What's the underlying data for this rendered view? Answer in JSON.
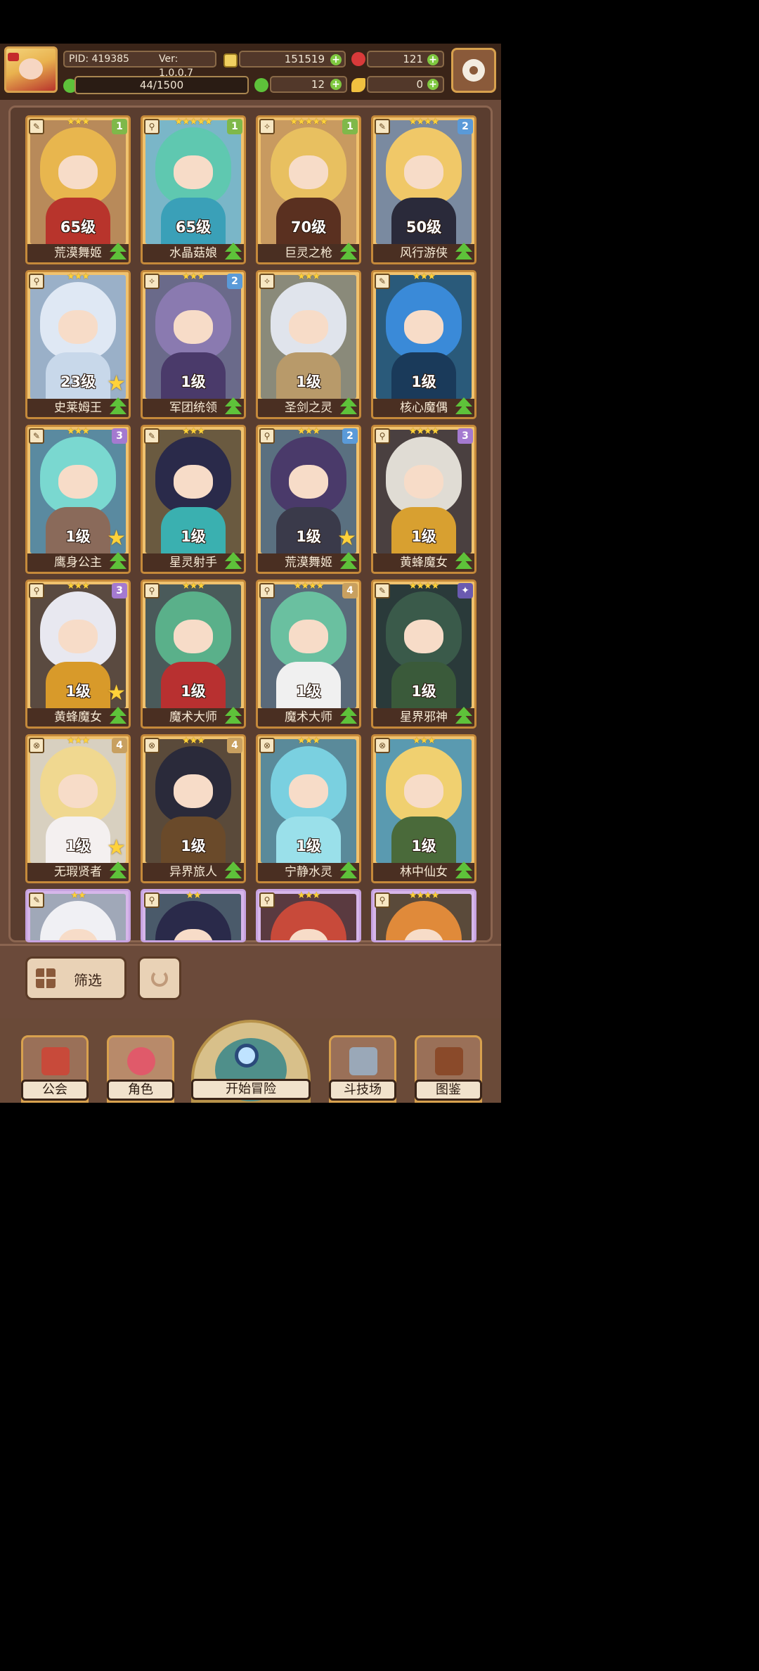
{
  "header": {
    "pid": "PID: 419385",
    "version": "Ver: 1.0.0.7",
    "gold": "151519",
    "gems": "121",
    "stamina": "44/1500",
    "clover": "12",
    "key": "0"
  },
  "cards": [
    {
      "stars": "★★★",
      "level": "65级",
      "name": "荒漠舞姬",
      "rank": "1",
      "rank_color": "#7fb84a",
      "hair": "#e8b64e",
      "bg": "#b88a5a",
      "outfit": "#b8342c",
      "fav": false,
      "type": "✎"
    },
    {
      "stars": "★★★★★",
      "level": "65级",
      "name": "水晶菇娘",
      "rank": "1",
      "rank_color": "#7fb84a",
      "hair": "#5fc8b0",
      "bg": "#7ab6c8",
      "outfit": "#3aa0b8",
      "fav": false,
      "type": "⚲"
    },
    {
      "stars": "★★★★★",
      "level": "70级",
      "name": "巨灵之枪",
      "rank": "1",
      "rank_color": "#7fb84a",
      "hair": "#e8c060",
      "bg": "#c89a60",
      "outfit": "#5a3020",
      "fav": false,
      "type": "✧"
    },
    {
      "stars": "★★★★",
      "level": "50级",
      "name": "风行游侠",
      "rank": "2",
      "rank_color": "#5a9ad8",
      "hair": "#f0c868",
      "bg": "#7a8aa0",
      "outfit": "#2a2a3a",
      "fav": false,
      "type": "✎"
    },
    {
      "stars": "★★★",
      "level": "23级",
      "name": "史莱姆王",
      "rank": "",
      "rank_color": "",
      "hair": "#dfe8f4",
      "bg": "#9ab0c8",
      "outfit": "#c8d8ea",
      "fav": true,
      "type": "⚲"
    },
    {
      "stars": "★★★",
      "level": "1级",
      "name": "军团统领",
      "rank": "2",
      "rank_color": "#5a9ad8",
      "hair": "#8a7ab0",
      "bg": "#6a6a8a",
      "outfit": "#4a3a6a",
      "fav": false,
      "type": "✧"
    },
    {
      "stars": "★★★",
      "level": "1级",
      "name": "圣剑之灵",
      "rank": "",
      "rank_color": "",
      "hair": "#e0e4ec",
      "bg": "#8a8a7a",
      "outfit": "#b89a6a",
      "fav": false,
      "type": "✧"
    },
    {
      "stars": "★★★",
      "level": "1级",
      "name": "核心魔偶",
      "rank": "",
      "rank_color": "",
      "hair": "#3a8ad8",
      "bg": "#2a5a7a",
      "outfit": "#1a3a5a",
      "fav": false,
      "type": "✎"
    },
    {
      "stars": "★★★",
      "level": "1级",
      "name": "鹰身公主",
      "rank": "3",
      "rank_color": "#a47ad0",
      "hair": "#7ad8d0",
      "bg": "#5a8aa0",
      "outfit": "#8a6a5a",
      "fav": true,
      "type": "✎"
    },
    {
      "stars": "★★★",
      "level": "1级",
      "name": "星灵射手",
      "rank": "",
      "rank_color": "",
      "hair": "#2a2a4a",
      "bg": "#6a5a40",
      "outfit": "#3ab0b0",
      "fav": false,
      "type": "✎"
    },
    {
      "stars": "★★★",
      "level": "1级",
      "name": "荒漠舞姬",
      "rank": "2",
      "rank_color": "#5a9ad8",
      "hair": "#4a3a6a",
      "bg": "#5a7080",
      "outfit": "#3a3a4a",
      "fav": true,
      "type": "⚲"
    },
    {
      "stars": "★★★★",
      "level": "1级",
      "name": "黄蜂魔女",
      "rank": "3",
      "rank_color": "#a47ad0",
      "hair": "#e0dcd4",
      "bg": "#4a4040",
      "outfit": "#d8a030",
      "fav": false,
      "type": "⚲"
    },
    {
      "stars": "★★★",
      "level": "1级",
      "name": "黄蜂魔女",
      "rank": "3",
      "rank_color": "#a47ad0",
      "hair": "#e8e8f0",
      "bg": "#5a4a40",
      "outfit": "#d89a2a",
      "fav": true,
      "type": "⚲"
    },
    {
      "stars": "★★★",
      "level": "1级",
      "name": "魔术大师",
      "rank": "",
      "rank_color": "",
      "hair": "#5ab08a",
      "bg": "#4a5a5a",
      "outfit": "#b83030",
      "fav": false,
      "type": "⚲"
    },
    {
      "stars": "★★★★",
      "level": "1级",
      "name": "魔术大师",
      "rank": "4",
      "rank_color": "#c8a060",
      "hair": "#6ac0a0",
      "bg": "#5a6a7a",
      "outfit": "#f0f0f0",
      "fav": false,
      "type": "⚲"
    },
    {
      "stars": "★★★★",
      "level": "1级",
      "name": "星界邪神",
      "rank": "✦",
      "rank_color": "#6a5ab0",
      "hair": "#3a5a4a",
      "bg": "#2a3a3a",
      "outfit": "#3a5a3a",
      "fav": false,
      "type": "✎"
    },
    {
      "stars": "★★★",
      "level": "1级",
      "name": "无瑕贤者",
      "rank": "4",
      "rank_color": "#c8a060",
      "hair": "#f0d890",
      "bg": "#d8d0c0",
      "outfit": "#f4f0f0",
      "fav": true,
      "type": "⊗"
    },
    {
      "stars": "★★★",
      "level": "1级",
      "name": "异界旅人",
      "rank": "4",
      "rank_color": "#c8a060",
      "hair": "#2a2a3a",
      "bg": "#5a4a3a",
      "outfit": "#6a4a2a",
      "fav": false,
      "type": "⊗"
    },
    {
      "stars": "★★★",
      "level": "1级",
      "name": "宁静水灵",
      "rank": "",
      "rank_color": "",
      "hair": "#7ad0e0",
      "bg": "#5a8a9a",
      "outfit": "#9ae0ea",
      "fav": false,
      "type": "⊗"
    },
    {
      "stars": "★★★",
      "level": "1级",
      "name": "林中仙女",
      "rank": "",
      "rank_color": "",
      "hair": "#f0d070",
      "bg": "#5a9ab0",
      "outfit": "#4a6a3a",
      "fav": false,
      "type": "⊗"
    }
  ],
  "partial_cards": [
    {
      "stars": "★★",
      "hair": "#f0f0f4",
      "bg": "#a0a8b8",
      "type": "✎"
    },
    {
      "stars": "★★",
      "hair": "#2a2a4a",
      "bg": "#4a5a6a",
      "type": "⚲"
    },
    {
      "stars": "★★★",
      "hair": "#c84a3a",
      "bg": "#5a3a40",
      "type": "⚲"
    },
    {
      "stars": "★★★★",
      "hair": "#e08a3a",
      "bg": "#5a4a3a",
      "type": "⚲"
    }
  ],
  "controls": {
    "filter_label": "筛选"
  },
  "nav": {
    "guild": "公会",
    "character": "角色",
    "adventure": "开始冒险",
    "arena": "斗技场",
    "codex": "图鉴"
  },
  "colors": {
    "gold_coin": "#f0d060",
    "gem": "#d83a3a",
    "clover": "#5ec23a",
    "key": "#f0c040"
  }
}
